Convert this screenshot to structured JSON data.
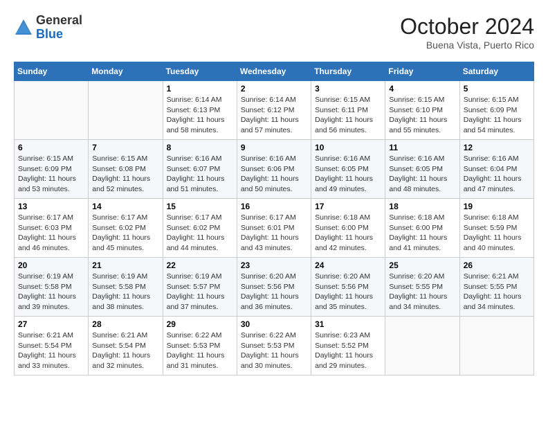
{
  "header": {
    "logo_line1": "General",
    "logo_line2": "Blue",
    "month": "October 2024",
    "location": "Buena Vista, Puerto Rico"
  },
  "weekdays": [
    "Sunday",
    "Monday",
    "Tuesday",
    "Wednesday",
    "Thursday",
    "Friday",
    "Saturday"
  ],
  "weeks": [
    [
      {
        "day": "",
        "content": ""
      },
      {
        "day": "",
        "content": ""
      },
      {
        "day": "1",
        "content": "Sunrise: 6:14 AM\nSunset: 6:13 PM\nDaylight: 11 hours and 58 minutes."
      },
      {
        "day": "2",
        "content": "Sunrise: 6:14 AM\nSunset: 6:12 PM\nDaylight: 11 hours and 57 minutes."
      },
      {
        "day": "3",
        "content": "Sunrise: 6:15 AM\nSunset: 6:11 PM\nDaylight: 11 hours and 56 minutes."
      },
      {
        "day": "4",
        "content": "Sunrise: 6:15 AM\nSunset: 6:10 PM\nDaylight: 11 hours and 55 minutes."
      },
      {
        "day": "5",
        "content": "Sunrise: 6:15 AM\nSunset: 6:09 PM\nDaylight: 11 hours and 54 minutes."
      }
    ],
    [
      {
        "day": "6",
        "content": "Sunrise: 6:15 AM\nSunset: 6:09 PM\nDaylight: 11 hours and 53 minutes."
      },
      {
        "day": "7",
        "content": "Sunrise: 6:15 AM\nSunset: 6:08 PM\nDaylight: 11 hours and 52 minutes."
      },
      {
        "day": "8",
        "content": "Sunrise: 6:16 AM\nSunset: 6:07 PM\nDaylight: 11 hours and 51 minutes."
      },
      {
        "day": "9",
        "content": "Sunrise: 6:16 AM\nSunset: 6:06 PM\nDaylight: 11 hours and 50 minutes."
      },
      {
        "day": "10",
        "content": "Sunrise: 6:16 AM\nSunset: 6:05 PM\nDaylight: 11 hours and 49 minutes."
      },
      {
        "day": "11",
        "content": "Sunrise: 6:16 AM\nSunset: 6:05 PM\nDaylight: 11 hours and 48 minutes."
      },
      {
        "day": "12",
        "content": "Sunrise: 6:16 AM\nSunset: 6:04 PM\nDaylight: 11 hours and 47 minutes."
      }
    ],
    [
      {
        "day": "13",
        "content": "Sunrise: 6:17 AM\nSunset: 6:03 PM\nDaylight: 11 hours and 46 minutes."
      },
      {
        "day": "14",
        "content": "Sunrise: 6:17 AM\nSunset: 6:02 PM\nDaylight: 11 hours and 45 minutes."
      },
      {
        "day": "15",
        "content": "Sunrise: 6:17 AM\nSunset: 6:02 PM\nDaylight: 11 hours and 44 minutes."
      },
      {
        "day": "16",
        "content": "Sunrise: 6:17 AM\nSunset: 6:01 PM\nDaylight: 11 hours and 43 minutes."
      },
      {
        "day": "17",
        "content": "Sunrise: 6:18 AM\nSunset: 6:00 PM\nDaylight: 11 hours and 42 minutes."
      },
      {
        "day": "18",
        "content": "Sunrise: 6:18 AM\nSunset: 6:00 PM\nDaylight: 11 hours and 41 minutes."
      },
      {
        "day": "19",
        "content": "Sunrise: 6:18 AM\nSunset: 5:59 PM\nDaylight: 11 hours and 40 minutes."
      }
    ],
    [
      {
        "day": "20",
        "content": "Sunrise: 6:19 AM\nSunset: 5:58 PM\nDaylight: 11 hours and 39 minutes."
      },
      {
        "day": "21",
        "content": "Sunrise: 6:19 AM\nSunset: 5:58 PM\nDaylight: 11 hours and 38 minutes."
      },
      {
        "day": "22",
        "content": "Sunrise: 6:19 AM\nSunset: 5:57 PM\nDaylight: 11 hours and 37 minutes."
      },
      {
        "day": "23",
        "content": "Sunrise: 6:20 AM\nSunset: 5:56 PM\nDaylight: 11 hours and 36 minutes."
      },
      {
        "day": "24",
        "content": "Sunrise: 6:20 AM\nSunset: 5:56 PM\nDaylight: 11 hours and 35 minutes."
      },
      {
        "day": "25",
        "content": "Sunrise: 6:20 AM\nSunset: 5:55 PM\nDaylight: 11 hours and 34 minutes."
      },
      {
        "day": "26",
        "content": "Sunrise: 6:21 AM\nSunset: 5:55 PM\nDaylight: 11 hours and 34 minutes."
      }
    ],
    [
      {
        "day": "27",
        "content": "Sunrise: 6:21 AM\nSunset: 5:54 PM\nDaylight: 11 hours and 33 minutes."
      },
      {
        "day": "28",
        "content": "Sunrise: 6:21 AM\nSunset: 5:54 PM\nDaylight: 11 hours and 32 minutes."
      },
      {
        "day": "29",
        "content": "Sunrise: 6:22 AM\nSunset: 5:53 PM\nDaylight: 11 hours and 31 minutes."
      },
      {
        "day": "30",
        "content": "Sunrise: 6:22 AM\nSunset: 5:53 PM\nDaylight: 11 hours and 30 minutes."
      },
      {
        "day": "31",
        "content": "Sunrise: 6:23 AM\nSunset: 5:52 PM\nDaylight: 11 hours and 29 minutes."
      },
      {
        "day": "",
        "content": ""
      },
      {
        "day": "",
        "content": ""
      }
    ]
  ]
}
